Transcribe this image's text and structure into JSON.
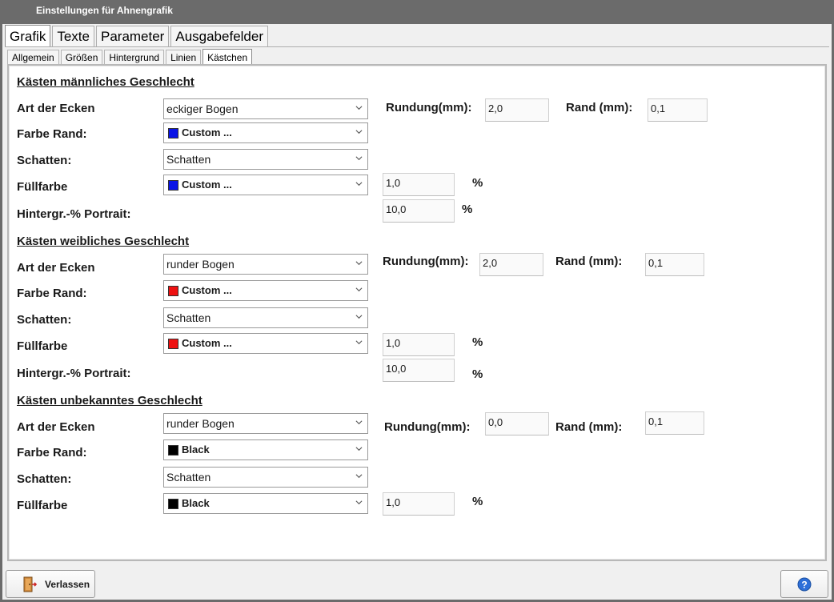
{
  "window": {
    "title": "Einstellungen für Ahnengrafik"
  },
  "main_tabs": [
    "Grafik",
    "Texte",
    "Parameter",
    "Ausgabefelder"
  ],
  "sub_tabs": [
    "Allgemein",
    "Größen",
    "Hintergrund",
    "Linien",
    "Kästchen"
  ],
  "labels": {
    "corners": "Art der Ecken",
    "border_color": "Farbe Rand:",
    "shadow": "Schatten:",
    "fill": "Füllfarbe",
    "bg_portrait": "Hintergr.-% Portrait:",
    "percent": "%",
    "rounding": "Rundung(mm):",
    "border": "Rand (mm):"
  },
  "male": {
    "header": "Kästen männliches Geschlecht",
    "corners": "eckiger Bogen",
    "rounding": "2,0",
    "border_mm": "0,1",
    "border_color": {
      "name": "Custom ...",
      "hex": "#0a14e6"
    },
    "shadow": "Schatten",
    "fill_color": {
      "name": "Custom ...",
      "hex": "#0a14e6"
    },
    "fill_percent": "1,0",
    "bg_percent": "10,0"
  },
  "female": {
    "header": "Kästen weibliches Geschlecht",
    "corners": "runder Bogen",
    "rounding": "2,0",
    "border_mm": "0,1",
    "border_color": {
      "name": "Custom ...",
      "hex": "#ee1111"
    },
    "shadow": "Schatten",
    "fill_color": {
      "name": "Custom ...",
      "hex": "#ee1111"
    },
    "fill_percent": "1,0",
    "bg_percent": "10,0"
  },
  "unknown": {
    "header": "Kästen unbekanntes Geschlecht",
    "corners": "runder Bogen",
    "rounding": "0,0",
    "border_mm": "0,1",
    "border_color": {
      "name": "Black",
      "hex": "#000000"
    },
    "shadow": "Schatten",
    "fill_color": {
      "name": "Black",
      "hex": "#000000"
    },
    "fill_percent": "1,0"
  },
  "footer": {
    "exit_label": "Verlassen"
  },
  "icons": {
    "exit": "exit-door-icon",
    "help": "help-icon",
    "dropdown": "chevron-down-icon"
  }
}
